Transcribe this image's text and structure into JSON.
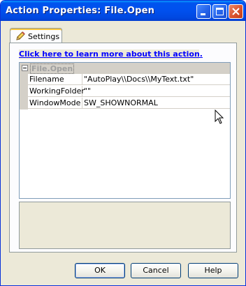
{
  "window": {
    "title": "Action Properties: File.Open"
  },
  "tabs": [
    {
      "label": "Settings",
      "icon": "pencil-icon"
    }
  ],
  "link": {
    "text": "Click here to learn more about this action."
  },
  "property_grid": {
    "category": "File.Open",
    "rows": [
      {
        "name": "Filename",
        "value": "\"AutoPlay\\\\Docs\\\\MyText.txt\""
      },
      {
        "name": "WorkingFolder",
        "value": "\"\""
      },
      {
        "name": "WindowMode",
        "value": "SW_SHOWNORMAL"
      }
    ]
  },
  "buttons": {
    "ok": "OK",
    "cancel": "Cancel",
    "help": "Help"
  },
  "colors": {
    "titlebar": "#0053ee",
    "link": "#0000ff",
    "dialog_bg": "#ece9d8"
  }
}
